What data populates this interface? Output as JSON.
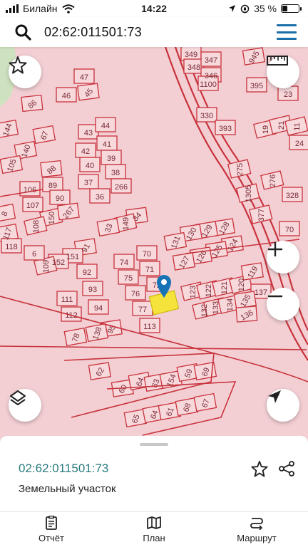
{
  "status_bar": {
    "carrier": "Билайн",
    "time": "14:22",
    "battery_percent": "35 %",
    "battery_level": 0.35
  },
  "search": {
    "query": "02:62:011501:73"
  },
  "map": {
    "parcel_labels": [
      "349",
      "348",
      "347",
      "945",
      "346",
      "1100",
      "395",
      "23",
      "330",
      "393",
      "19",
      "21",
      "11",
      "24",
      "47",
      "46",
      "45",
      "86",
      "144",
      "140",
      "67",
      "105",
      "43",
      "44",
      "42",
      "41",
      "40",
      "39",
      "37",
      "38",
      "36",
      "266",
      "88",
      "106",
      "89",
      "107",
      "90",
      "150",
      "267",
      "108",
      "8",
      "117",
      "118",
      "34",
      "149",
      "33",
      "128",
      "129",
      "130",
      "131",
      "124",
      "125",
      "126",
      "127",
      "91",
      "151",
      "152",
      "109",
      "6",
      "92",
      "74",
      "70",
      "75",
      "71",
      "93",
      "76",
      "111",
      "72",
      "94",
      "77",
      "112",
      "95",
      "138",
      "113",
      "78",
      "123",
      "122",
      "121",
      "120",
      "119",
      "137",
      "132",
      "133",
      "134",
      "135",
      "136",
      "275",
      "1305",
      "276",
      "328",
      "377",
      "70",
      "62",
      "60",
      "64",
      "63",
      "154",
      "59",
      "69",
      "65",
      "64",
      "61",
      "68",
      "67"
    ],
    "colors": {
      "background": "#f3cfd3",
      "parcel_line": "#c8323c",
      "marker": "#1673b5",
      "selected_parcel": "#f5e23a"
    }
  },
  "sheet": {
    "cadastral_number": "02:62:011501:73",
    "object_type": "Земельный участок"
  },
  "tabs": [
    {
      "label": "Отчёт",
      "icon": "report-icon"
    },
    {
      "label": "План",
      "icon": "map-plan-icon"
    },
    {
      "label": "Маршрут",
      "icon": "route-icon"
    }
  ]
}
